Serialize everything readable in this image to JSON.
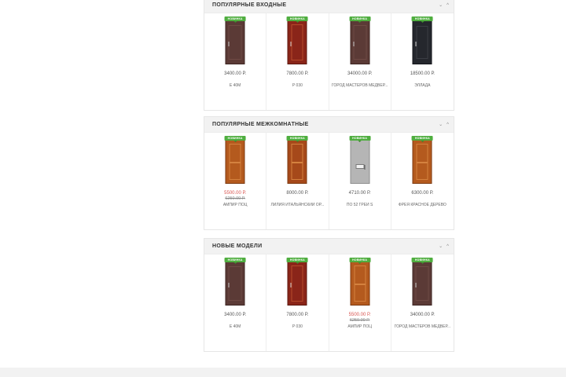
{
  "sections": [
    {
      "title": "Популярные входные",
      "ctrl_down": "⌄",
      "ctrl_up": "^",
      "products": [
        {
          "badge": "Новинка",
          "price": "3400.00 Р.",
          "old_price": "",
          "name": "Е 40М",
          "door": "brown"
        },
        {
          "badge": "Новинка",
          "price": "7800.00 Р.",
          "old_price": "",
          "name": "Р 030",
          "door": "red"
        },
        {
          "badge": "Новинка",
          "price": "34000.00 Р.",
          "old_price": "",
          "name": "ГОРОД МАСТЕРОВ МЕДВЕР...",
          "door": "brown"
        },
        {
          "badge": "Новинка",
          "price": "18500.00 Р.",
          "old_price": "",
          "name": "ЭЛЛАДА",
          "door": "dark"
        }
      ]
    },
    {
      "title": "Популярные межкомнатные",
      "ctrl_down": "⌄",
      "ctrl_up": "^",
      "products": [
        {
          "badge": "Новинка",
          "price": "5500.00 Р.",
          "old_price": "6250.00 Р.",
          "name": "АМПИР ПОЦ",
          "door": "orange"
        },
        {
          "badge": "Новинка",
          "price": "8000.00 Р.",
          "old_price": "",
          "name": "ЛИЛИЯ ИТАЛЬЯНСКИЙ ОР...",
          "door": "orange"
        },
        {
          "badge": "Новинка",
          "price": "4710.00 Р.",
          "old_price": "",
          "name": "ПО 52 ГРЕЙ S",
          "door": "grey"
        },
        {
          "badge": "Новинка",
          "price": "6300.00 Р.",
          "old_price": "",
          "name": "ФРЕЯ КРАСНОЕ ДЕРЕВО",
          "door": "orange"
        }
      ]
    },
    {
      "title": "Новые модели",
      "ctrl_down": "⌄",
      "ctrl_up": "^",
      "products": [
        {
          "badge": "Новинка",
          "price": "3400.00 Р.",
          "old_price": "",
          "name": "Е 40М",
          "door": "brown"
        },
        {
          "badge": "Новинка",
          "price": "7800.00 Р.",
          "old_price": "",
          "name": "Р 030",
          "door": "red"
        },
        {
          "badge": "Новинка",
          "price": "5500.00 Р.",
          "old_price": "6250.00 Р.",
          "name": "АМПИР ПОЦ",
          "door": "orange"
        },
        {
          "badge": "Новинка",
          "price": "34000.00 Р.",
          "old_price": "",
          "name": "ГОРОД МАСТЕРОВ МЕДВЕР...",
          "door": "brown"
        }
      ]
    }
  ],
  "colors": {
    "badge": "#4fae3f",
    "sale_price": "#d9534f",
    "header_bg": "#f2f2f2"
  }
}
